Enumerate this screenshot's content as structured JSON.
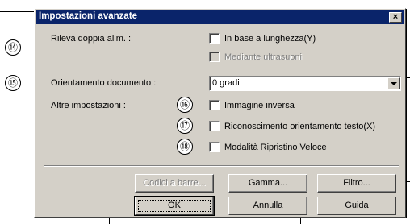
{
  "dialog": {
    "title": "Impostazioni avanzate",
    "close_glyph": "×"
  },
  "callouts": [
    "⑭",
    "⑮",
    "⑯",
    "⑰",
    "⑱"
  ],
  "settings": {
    "double_feed_label": "Rileva doppia alim. :",
    "by_length_label": "In base a lunghezza(Y)",
    "by_length_checked": false,
    "ultrasound_label": "Mediante ultrasuoni",
    "ultrasound_enabled": false,
    "orientation_label": "Orientamento documento :",
    "orientation_value": "0 gradi",
    "other_label": "Altre impostazioni :",
    "invert_label": "Immagine inversa",
    "text_orient_label": "Riconoscimento orientamento testo(X)",
    "fast_recovery_label": "Modalità Ripristino Veloce"
  },
  "buttons": {
    "barcode": "Codici a barre...",
    "gamma": "Gamma...",
    "filter": "Filtro...",
    "ok": "OK",
    "cancel": "Annulla",
    "help": "Guida"
  }
}
